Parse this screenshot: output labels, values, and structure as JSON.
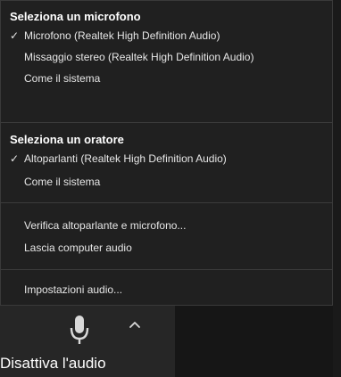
{
  "microphone": {
    "title": "Seleziona un microfono",
    "items": [
      {
        "label": "Microfono (Realtek High Definition Audio)",
        "checked": true
      },
      {
        "label": "Missaggio stereo (Realtek High Definition Audio)",
        "checked": false
      },
      {
        "label": "Come il sistema",
        "checked": false
      }
    ]
  },
  "speaker": {
    "title": "Seleziona un oratore",
    "items": [
      {
        "label": "Altoparlanti (Realtek High Definition Audio)",
        "checked": true
      },
      {
        "label": "Come il sistema",
        "checked": false
      }
    ]
  },
  "actions": {
    "test": "Verifica altoparlante e microfono...",
    "leave": "Lascia computer audio",
    "settings": "Impostazioni audio..."
  },
  "toolbar": {
    "mute_label": "Disattiva l'audio"
  },
  "icons": {
    "check": "✓"
  },
  "colors": {
    "menu_bg": "#202020",
    "toolbar_bg": "#161616",
    "text": "#e6e6e6",
    "title": "#ffffff"
  }
}
